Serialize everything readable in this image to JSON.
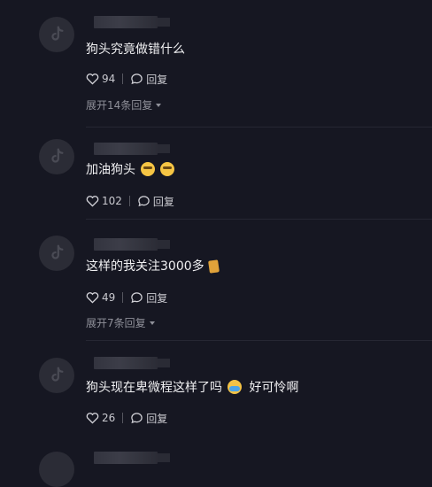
{
  "comments": [
    {
      "text": "狗头究竟做错什么",
      "likes": "94",
      "reply_label": "回复",
      "expand": "展开14条回复",
      "emoji": ""
    },
    {
      "text": "加油狗头",
      "likes": "102",
      "reply_label": "回复",
      "expand": "",
      "emoji": "smirk-face-emoji"
    },
    {
      "text": "这样的我关注3000多",
      "likes": "49",
      "reply_label": "回复",
      "expand": "展开7条回复",
      "emoji": "card-emoji"
    },
    {
      "text": "狗头现在卑微程这样了吗",
      "text_tail": "好可怜啊",
      "likes": "26",
      "reply_label": "回复",
      "expand": "",
      "emoji": "crying-face-emoji"
    }
  ]
}
